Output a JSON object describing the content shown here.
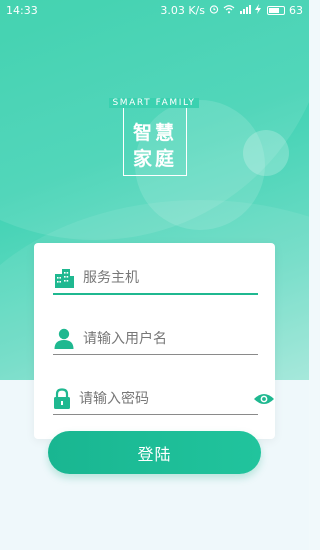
{
  "status_bar": {
    "time": "14:33",
    "speed": "3.03 K/s",
    "battery": "63"
  },
  "logo": {
    "english": "SMART FAMILY",
    "chinese_line1": "智慧",
    "chinese_line2": "家庭"
  },
  "form": {
    "host_placeholder": "服务主机",
    "username_placeholder": "请输入用户名",
    "password_placeholder": "请输入密码"
  },
  "login_button": "登陆",
  "colors": {
    "accent": "#1fb890",
    "hero_top": "#2fcea8",
    "background": "#eff8fb"
  },
  "icons": {
    "host": "building-icon",
    "user": "person-icon",
    "password": "lock-icon",
    "visibility": "eye-icon"
  }
}
